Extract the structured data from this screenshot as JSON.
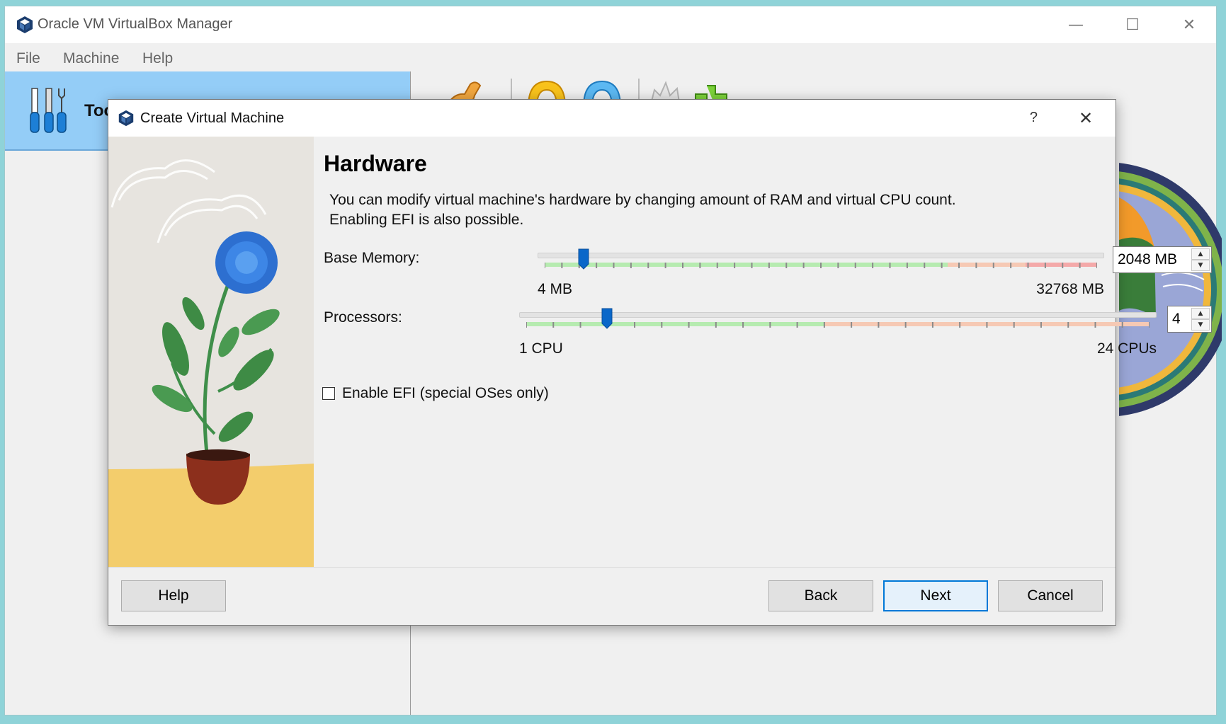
{
  "window": {
    "title": "Oracle VM VirtualBox Manager",
    "minimize": "—",
    "maximize": "☐",
    "close": "✕"
  },
  "menu": {
    "items": [
      "File",
      "Machine",
      "Help"
    ]
  },
  "sidebar": {
    "tools_label": "Too"
  },
  "dialog": {
    "title": "Create Virtual Machine",
    "help_glyph": "?",
    "close_glyph": "✕",
    "heading": "Hardware",
    "description_line1": "You can modify virtual machine's hardware by changing amount of RAM and virtual CPU count.",
    "description_line2": "Enabling EFI is also possible.",
    "memory": {
      "label": "Base Memory:",
      "min_label": "4 MB",
      "max_label": "32768 MB",
      "value": "2048 MB",
      "value_mb": 2048,
      "min_mb": 4,
      "max_mb": 32768,
      "handle_fraction": 0.07,
      "zones": [
        0.73,
        0.14,
        0.13
      ]
    },
    "processors": {
      "label": "Processors:",
      "min_label": "1 CPU",
      "max_label": "24 CPUs",
      "value": "4",
      "count": 4,
      "min": 1,
      "max": 24,
      "handle_fraction": 0.13,
      "zones": [
        0.48,
        0.52
      ]
    },
    "efi": {
      "label": "Enable EFI (special OSes only)",
      "checked": false
    },
    "buttons": {
      "help": "Help",
      "back": "Back",
      "next": "Next",
      "cancel": "Cancel"
    }
  },
  "colors": {
    "accent": "#0078d7",
    "tools_highlight": "#94cdf7",
    "zone_green": "#b6ebb0",
    "zone_orange": "#f6c9b4",
    "zone_red": "#f4a9a9"
  }
}
